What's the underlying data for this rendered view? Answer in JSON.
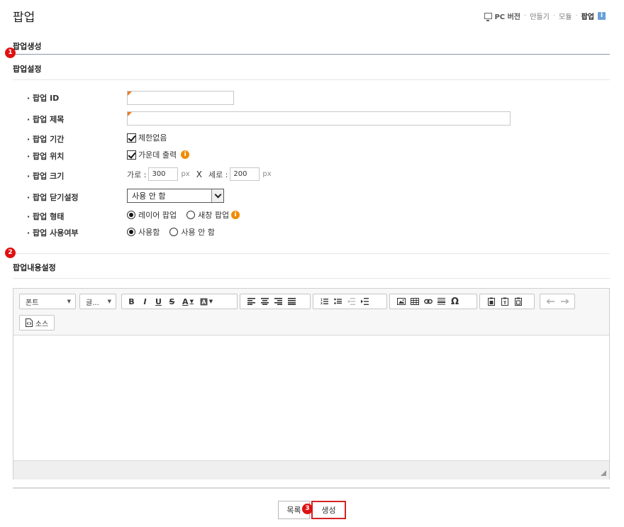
{
  "header": {
    "title": "팝업",
    "breadcrumb": [
      "PC 버전",
      "만들기",
      "모듈",
      "팝업"
    ],
    "info_icon": "i"
  },
  "section_title": "팝업생성",
  "badges": {
    "one": "1",
    "two": "2",
    "three": "3"
  },
  "settings": {
    "title": "팝업설정",
    "fields": {
      "id_label": "· 팝업 ID",
      "title_label": "· 팝업 제목",
      "period_label": "· 팝업 기간",
      "position_label": "· 팝업 위치",
      "size_label": "· 팝업 크기",
      "close_label": "· 팝업 닫기설정",
      "type_label": "· 팝업 형태",
      "use_label": "· 팝업 사용여부"
    },
    "period_checkbox": "제한없음",
    "position_checkbox": "가운데 출력",
    "size": {
      "width_label": "가로 :",
      "width_value": "300",
      "unit": "px",
      "times": "X",
      "height_label": "세로 :",
      "height_value": "200"
    },
    "close_setting_value": "사용 안 함",
    "type_options": [
      "레이어 팝업",
      "새창 팝업"
    ],
    "use_options": [
      "사용함",
      "사용 안 함"
    ]
  },
  "content_settings": {
    "title": "팝업내용설정",
    "toolbar": {
      "font_label": "폰트",
      "size_label": "글...",
      "source_label": "소스",
      "bold": "B",
      "italic": "I",
      "underline": "U",
      "strike": "S",
      "font_color": "A",
      "omega": "Ω"
    }
  },
  "buttons": {
    "list": "목록",
    "create": "생성"
  },
  "colors": {
    "badge": "#e01010",
    "required_marker": "#f07a1e",
    "info": "#f08c00",
    "highlight": "#d42424"
  }
}
